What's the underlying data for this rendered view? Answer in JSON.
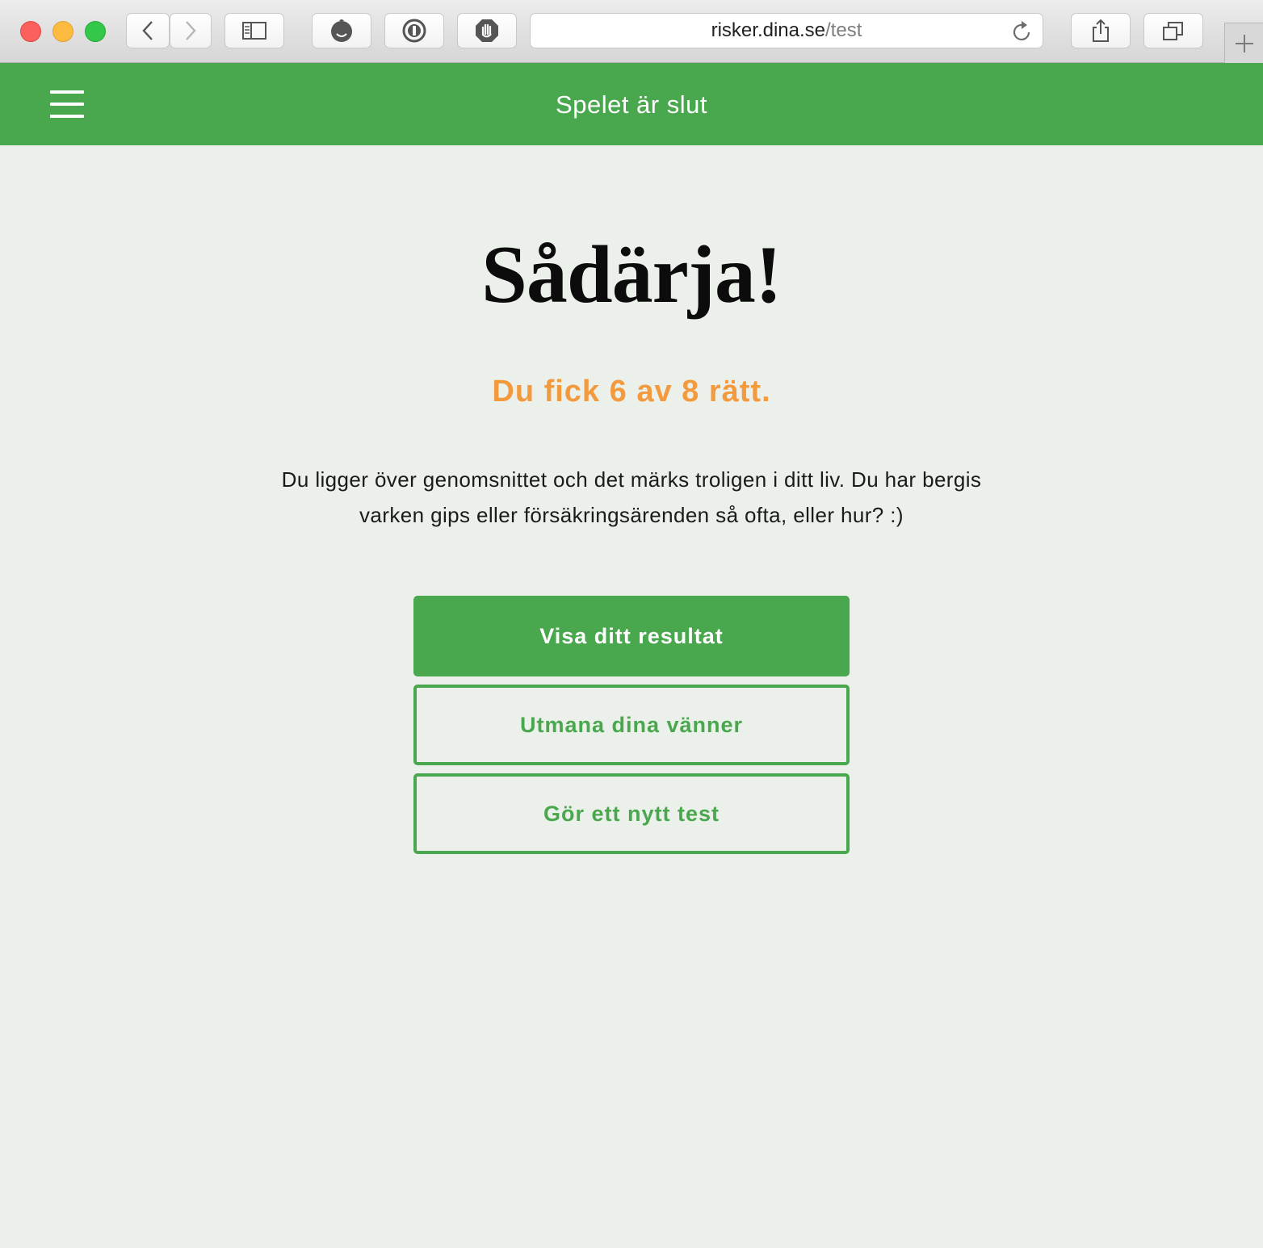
{
  "browser": {
    "url_host": "risker.dina.se",
    "url_path": "/test"
  },
  "app": {
    "header_title": "Spelet är slut"
  },
  "result": {
    "headline": "Sådärja!",
    "score_text": "Du fick 6 av 8 rätt.",
    "description": "Du ligger över genomsnittet och det märks troligen i ditt liv. Du har bergis varken gips eller försäkringsärenden så ofta, eller hur? :)"
  },
  "actions": {
    "show_result": "Visa ditt resultat",
    "challenge_friends": "Utmana dina vänner",
    "new_test": "Gör ett nytt test"
  },
  "colors": {
    "brand_green": "#49a74e",
    "score_orange": "#f39a3e",
    "page_background": "#ecf0ea"
  }
}
